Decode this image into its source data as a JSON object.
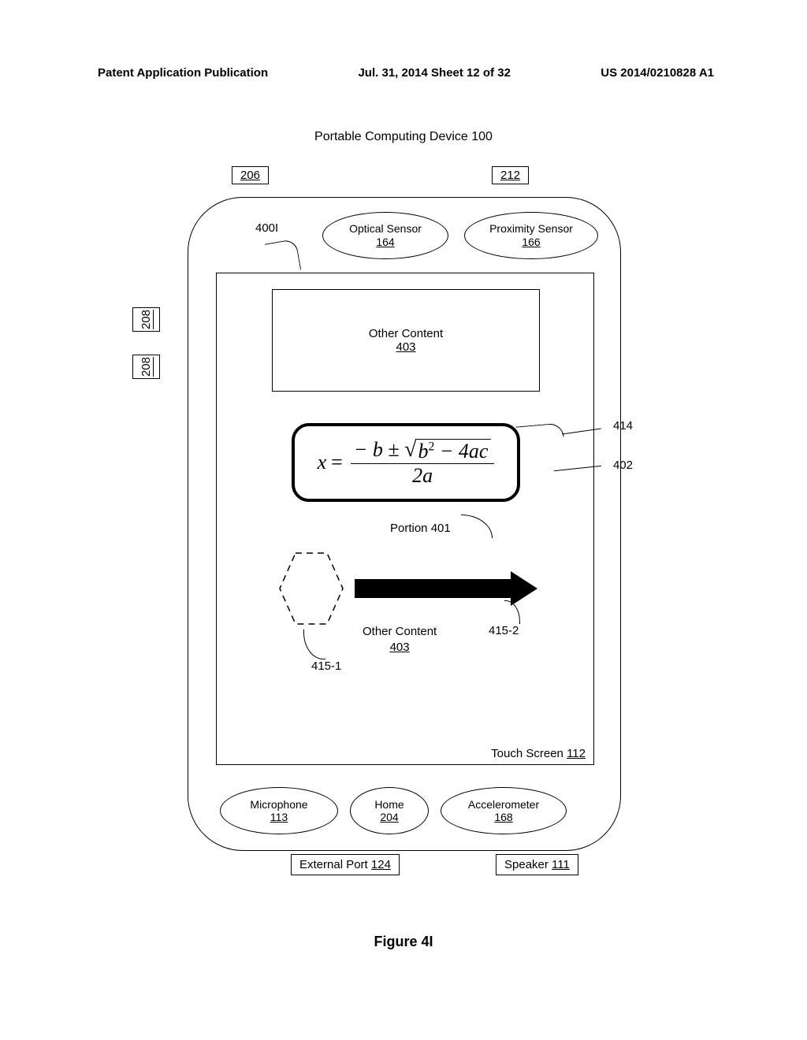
{
  "header": {
    "left": "Patent Application Publication",
    "center": "Jul. 31, 2014  Sheet 12 of 32",
    "right": "US 2014/0210828 A1"
  },
  "device_title": "Portable Computing Device 100",
  "refs": {
    "r206": "206",
    "r212": "212",
    "r208": "208",
    "r400I": "400I",
    "r414": "414",
    "r402": "402",
    "r4151": "415-1",
    "r4152": "415-2"
  },
  "optical": {
    "label": "Optical Sensor",
    "num": "164"
  },
  "proximity": {
    "label": "Proximity Sensor",
    "num": "166"
  },
  "other_content": {
    "label": "Other Content",
    "num": "403"
  },
  "portion_label": "Portion 401",
  "touch_screen": {
    "label": "Touch Screen",
    "num": "112"
  },
  "mic": {
    "label": "Microphone",
    "num": "113"
  },
  "home": {
    "label": "Home",
    "num": "204"
  },
  "accel": {
    "label": "Accelerometer",
    "num": "168"
  },
  "ext_port": {
    "label": "External Port",
    "num": "124"
  },
  "speaker": {
    "label": "Speaker",
    "num": "111"
  },
  "equation": {
    "lhs": "x",
    "numerator_part1": "− b ±",
    "undersqrt": "b² − 4ac",
    "denominator": "2a"
  },
  "figure_caption": "Figure 4I"
}
